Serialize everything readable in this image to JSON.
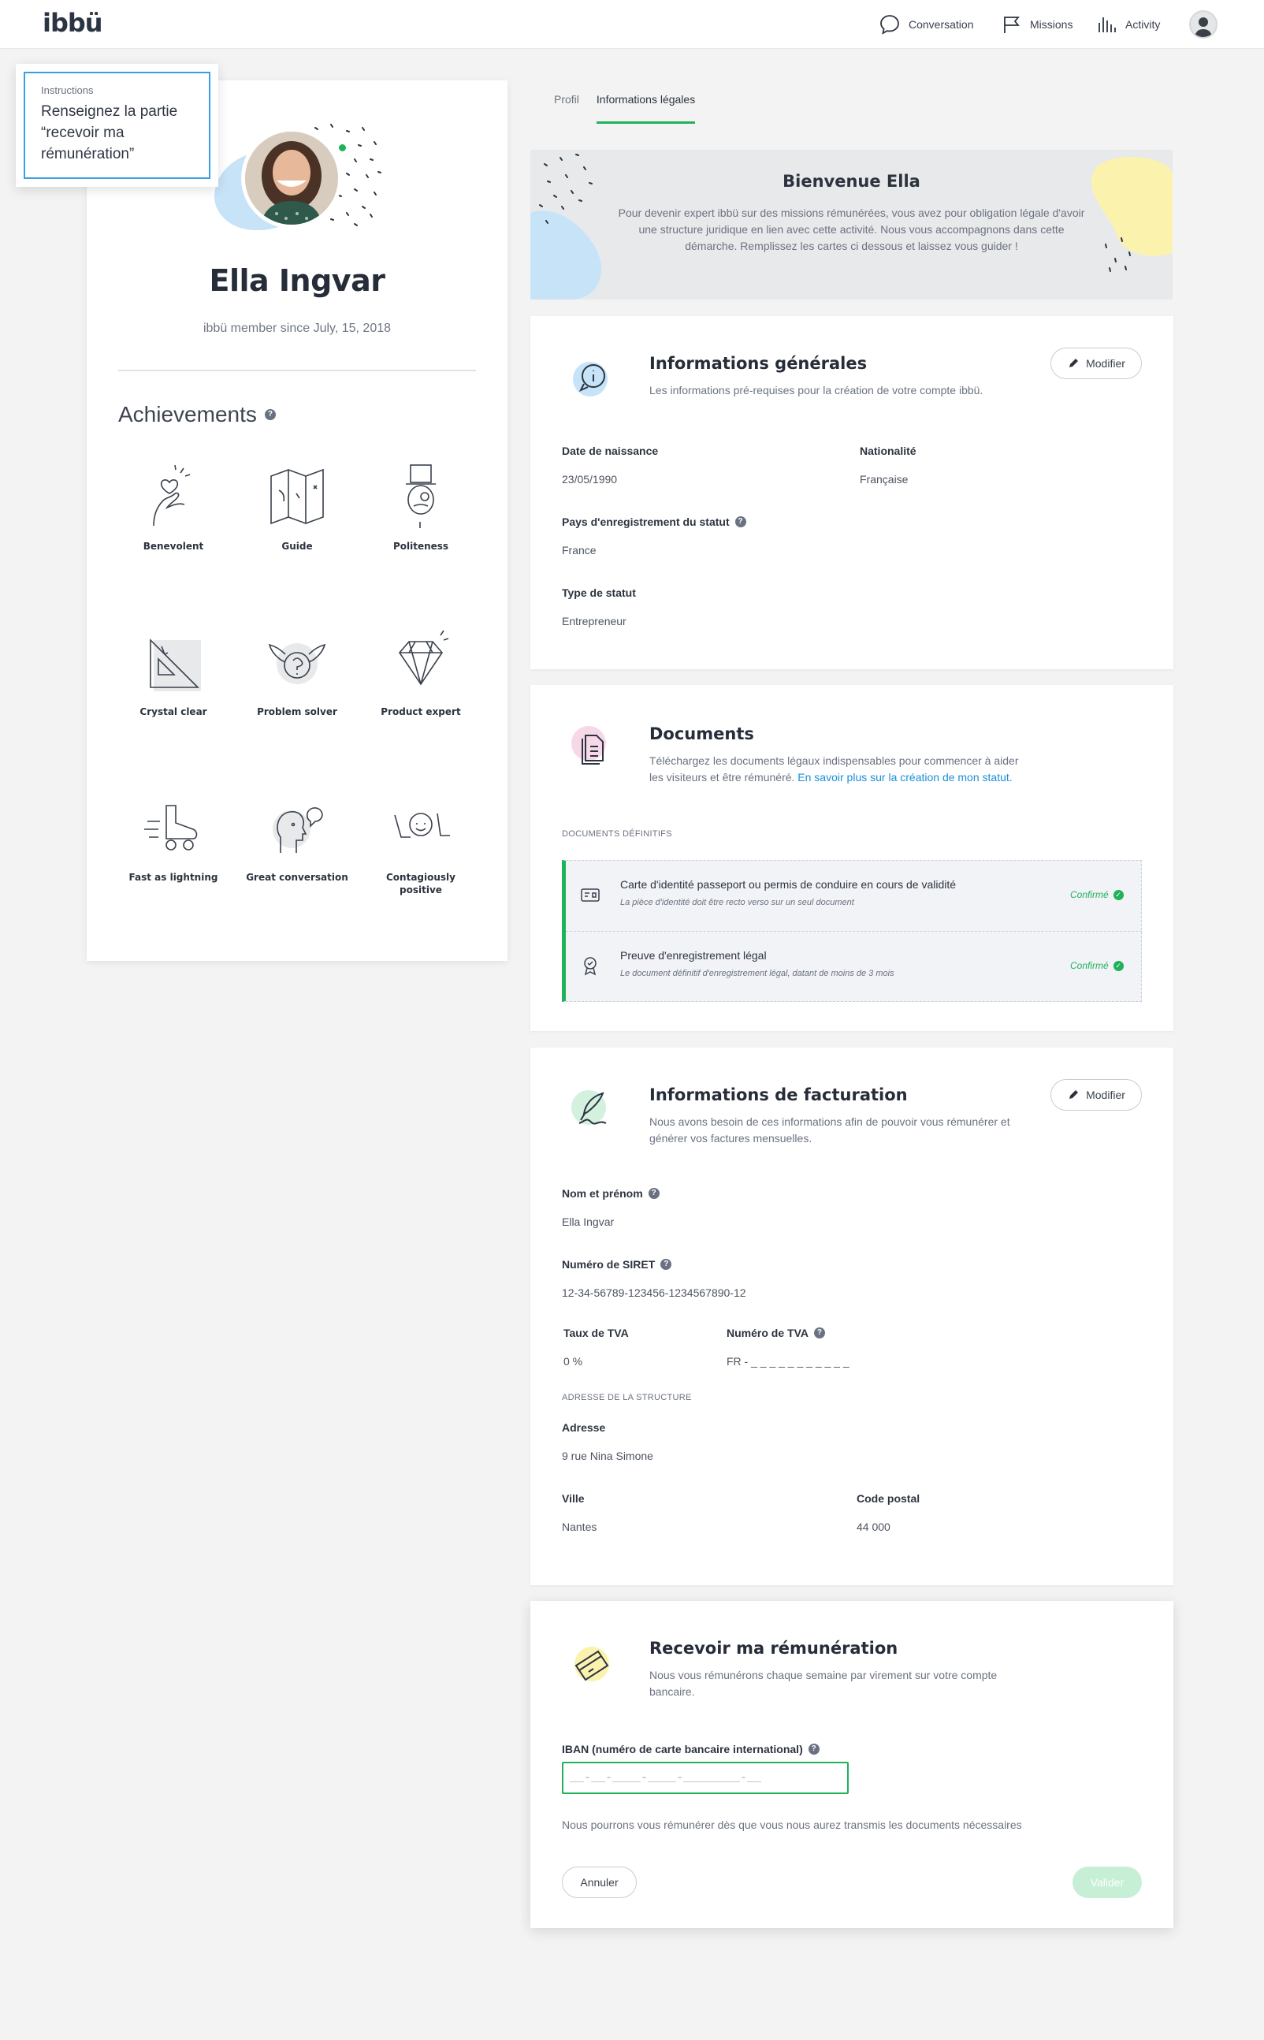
{
  "header": {
    "logo": "ibbü",
    "nav": [
      {
        "label": "Conversation",
        "icon": "chat-bubble-icon"
      },
      {
        "label": "Missions",
        "icon": "flag-icon"
      },
      {
        "label": "Activity",
        "icon": "bar-chart-icon"
      }
    ]
  },
  "instructions": {
    "title": "Instructions",
    "text": "Renseignez la partie “recevoir ma rémunération”"
  },
  "profile": {
    "name": "Ella Ingvar",
    "member_since": "ibbü member since July, 15, 2018",
    "achievements_title": "Achievements",
    "achievements": [
      {
        "label": "Benevolent",
        "icon": "hand-heart-icon"
      },
      {
        "label": "Guide",
        "icon": "map-icon"
      },
      {
        "label": "Politeness",
        "icon": "gentleman-hat-icon"
      },
      {
        "label": "Crystal clear",
        "icon": "set-square-icon"
      },
      {
        "label": "Problem solver",
        "icon": "winged-question-icon"
      },
      {
        "label": "Product expert",
        "icon": "diamond-icon"
      },
      {
        "label": "Fast as lightning",
        "icon": "roller-skate-icon"
      },
      {
        "label": "Great conversation",
        "icon": "talking-head-icon"
      },
      {
        "label": "Contagiously positive",
        "icon": "lol-icon"
      }
    ]
  },
  "tabs": [
    {
      "label": "Profil",
      "active": false
    },
    {
      "label": "Informations légales",
      "active": true
    }
  ],
  "banner": {
    "title": "Bienvenue Ella",
    "text": "Pour devenir expert ibbü sur des missions rémunérées, vous avez pour obligation légale d'avoir une structure juridique en lien avec cette activité. Nous vous accompagnons dans cette démarche. Remplissez les cartes ci dessous et laissez vous guider !"
  },
  "general": {
    "title": "Informations générales",
    "subtitle": "Les informations pré-requises pour la création de votre compte ibbü.",
    "modify": "Modifier",
    "birth_label": "Date de naissance",
    "birth_value": "23/05/1990",
    "nationality_label": "Nationalité",
    "nationality_value": "Française",
    "country_label": "Pays d'enregistrement du statut",
    "country_value": "France",
    "status_label": "Type de statut",
    "status_value": "Entrepreneur"
  },
  "documents": {
    "title": "Documents",
    "subtitle": "Téléchargez les documents légaux indispensables pour commencer à aider les visiteurs et être rémunéré.",
    "link": "En savoir plus sur la création de mon statut.",
    "section": "DOCUMENTS DÉFINITIFS",
    "items": [
      {
        "title": "Carte d'identité passeport ou permis de conduire en cours de validité",
        "desc": "La pièce d'identité doit être recto verso sur un seul document",
        "status": "Confirmé",
        "icon": "id-card-icon"
      },
      {
        "title": "Preuve d'enregistrement légal",
        "desc": "Le document définitif d'enregistrement légal, datant de moins de 3 mois",
        "status": "Confirmé",
        "icon": "award-ribbon-icon"
      }
    ]
  },
  "billing": {
    "title": "Informations de facturation",
    "subtitle": "Nous avons besoin de ces informations afin de pouvoir vous rémunérer et générer vos factures mensuelles.",
    "modify": "Modifier",
    "name_label": "Nom et prénom",
    "name_value": "Ella Ingvar",
    "siret_label": "Numéro de SIRET",
    "siret_value": "12-34-56789-123456-1234567890-12",
    "vat_rate_label": "Taux de TVA",
    "vat_rate_value": "0 %",
    "vat_number_label": "Numéro de TVA",
    "vat_number_value": "FR - _ _ _ _ _ _ _ _ _ _ _",
    "address_section": "ADRESSE DE LA STRUCTURE",
    "address_label": "Adresse",
    "address_value": "9 rue Nina Simone",
    "city_label": "Ville",
    "city_value": "Nantes",
    "postal_label": "Code postal",
    "postal_value": "44 000"
  },
  "payment": {
    "title": "Recevoir ma rémunération",
    "subtitle": "Nous vous rémunérons chaque semaine par virement sur votre compte bancaire.",
    "iban_label": "IBAN (numéro de carte bancaire international)",
    "iban_placeholder": "__-__-____-____-________-__",
    "note": "Nous pourrons vous rémunérer dès que vous nous aurez transmis les documents nécessaires",
    "cancel": "Annuler",
    "validate": "Valider"
  },
  "colors": {
    "accent_green": "#1fb25a",
    "link_blue": "#1b8fd8",
    "instruction_border": "#3c9ee0"
  }
}
